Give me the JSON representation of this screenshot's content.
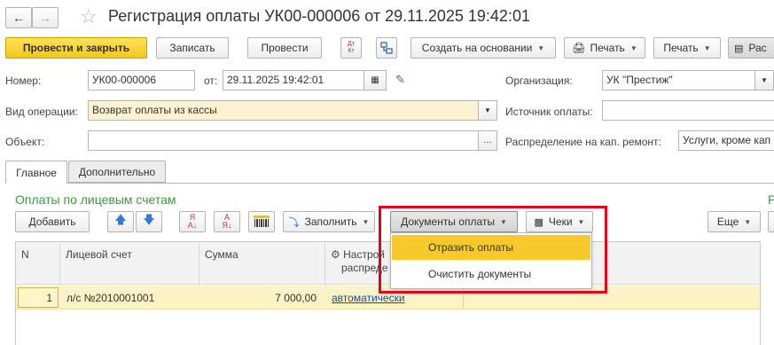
{
  "header": {
    "title": "Регистрация оплаты УК00-000006 от 29.11.2025 19:42:01"
  },
  "toolbar": {
    "post_close": "Провести и закрыть",
    "save": "Записать",
    "post": "Провести",
    "dt_kt": "Дт Кт",
    "create_based": "Создать на основании",
    "print_icon_label": "Печать",
    "print": "Печать",
    "print_partial": "Рас"
  },
  "form": {
    "number_label": "Номер:",
    "number_value": "УК00-000006",
    "date_label": "от:",
    "date_value": "29.11.2025 19:42:01",
    "org_label": "Организация:",
    "org_value": "УК \"Престиж\"",
    "operation_label": "Вид операции:",
    "operation_value": "Возврат оплаты из кассы",
    "source_label": "Источник оплаты:",
    "source_value": "",
    "object_label": "Объект:",
    "object_value": "",
    "distribution_label": "Распределение на кап. ремонт:",
    "distribution_value": "Услуги, кроме кап"
  },
  "tabs": [
    {
      "label": "Главное"
    },
    {
      "label": "Дополнительно"
    }
  ],
  "section": {
    "title": "Оплаты по лицевым счетам",
    "right_letter": "Р"
  },
  "table_toolbar": {
    "add": "Добавить",
    "fill": "Заполнить",
    "payment_docs": "Документы оплаты",
    "checks": "Чеки",
    "more": "Еще"
  },
  "dropdown": {
    "items": [
      "Отразить оплаты",
      "Очистить документы"
    ]
  },
  "table": {
    "headers": [
      "N",
      "Лицевой счет",
      "Сумма",
      "Настрой",
      "распреде"
    ],
    "rows": [
      {
        "n": "1",
        "account": "л/с №2010001001",
        "sum": "7 000,00",
        "mode": "автоматически"
      }
    ]
  },
  "colors": {
    "accent_yellow": "#f7d63a",
    "highlight_red": "#e0001a",
    "section_green": "#3a9a3a",
    "row_selected": "#fbf2c6"
  }
}
